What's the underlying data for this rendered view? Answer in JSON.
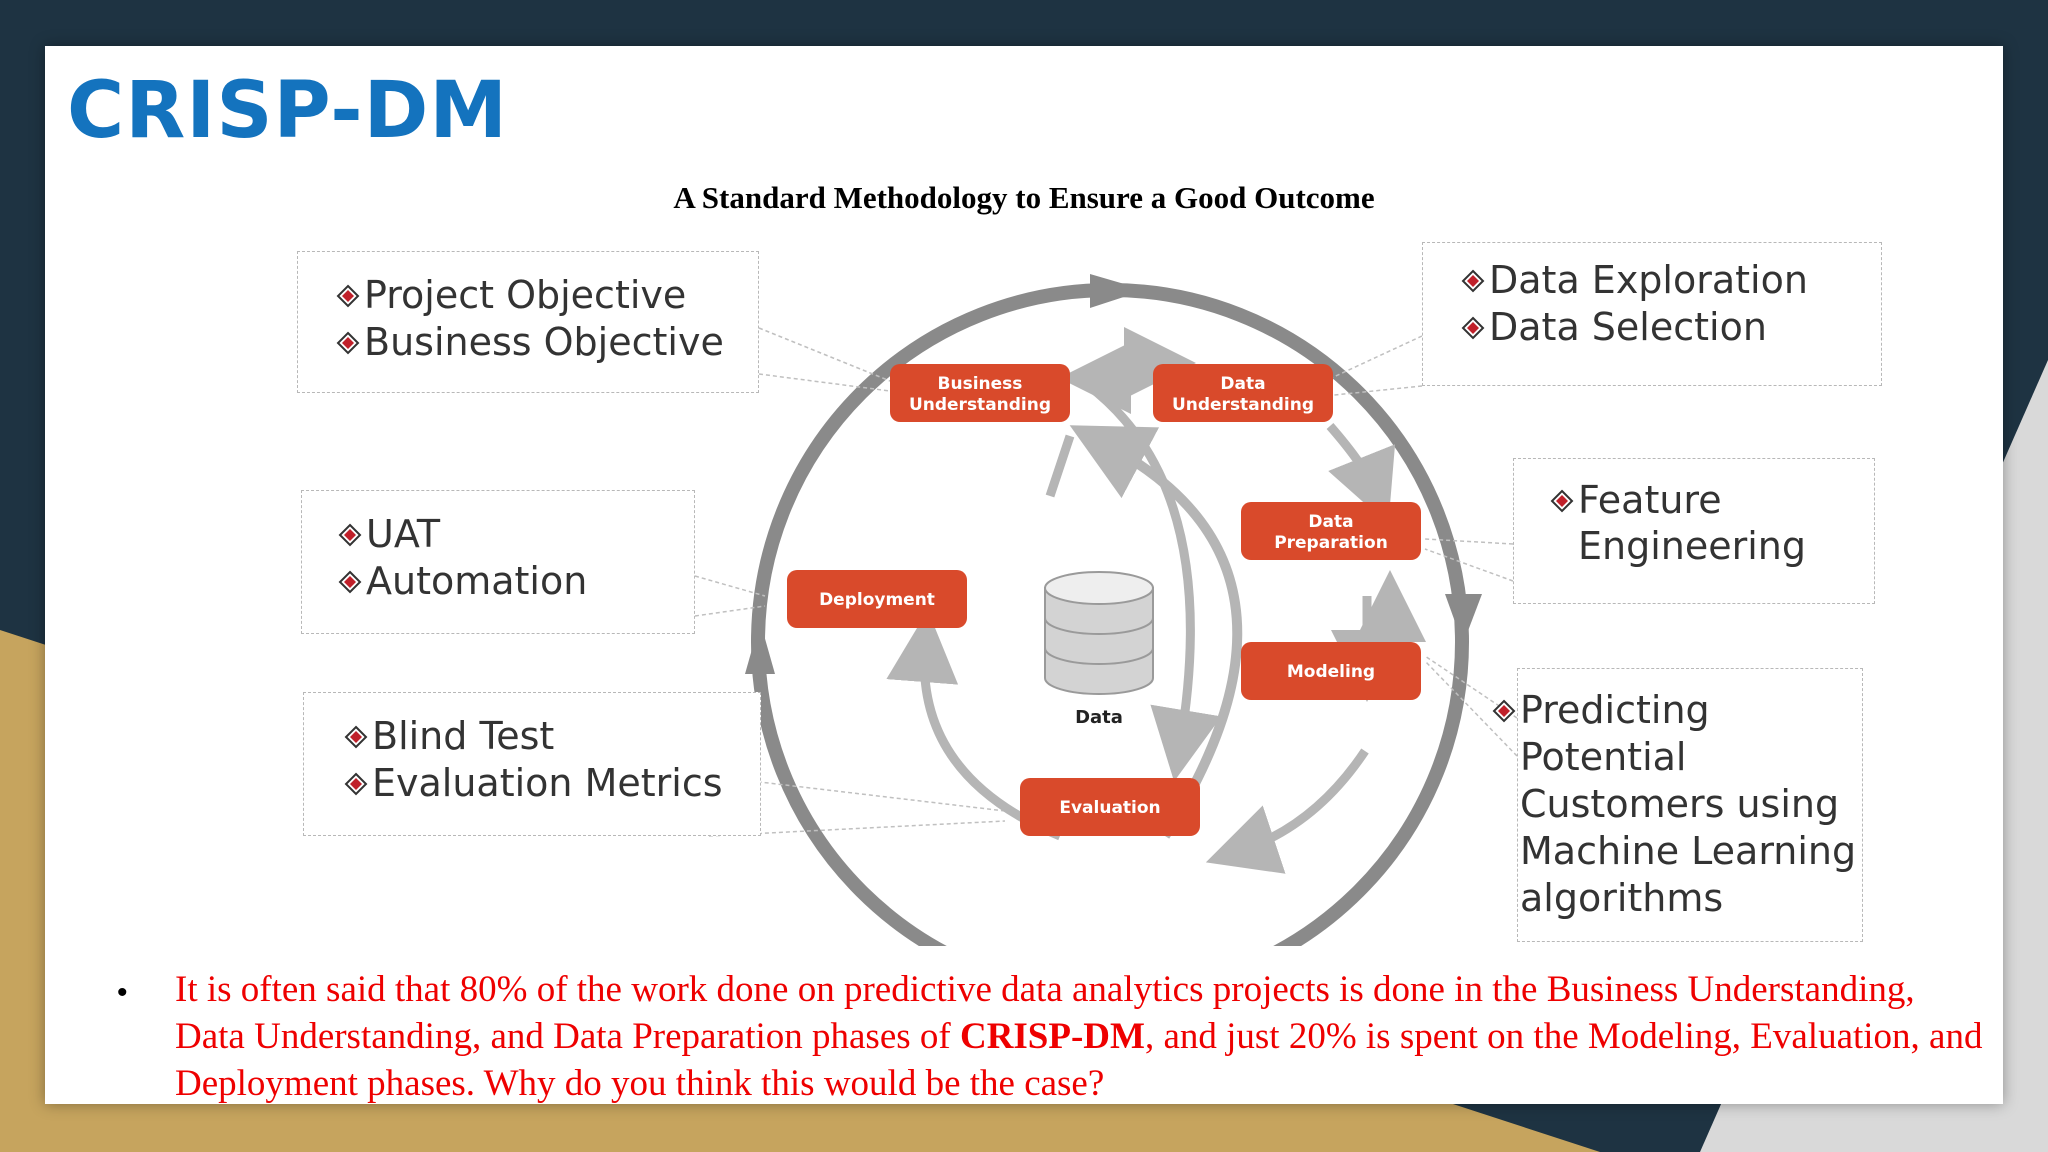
{
  "title": "CRISP-DM",
  "subtitle": "A Standard Methodology to Ensure a Good Outcome",
  "phases": {
    "business_understanding": [
      "Business",
      "Understanding"
    ],
    "data_understanding": [
      "Data",
      "Understanding"
    ],
    "data_preparation": [
      "Data",
      "Preparation"
    ],
    "modeling": "Modeling",
    "evaluation": "Evaluation",
    "deployment": "Deployment"
  },
  "data_label": "Data",
  "callouts": {
    "business": [
      "Project Objective",
      "Business Objective"
    ],
    "data_understanding": [
      "Data Exploration",
      "Data Selection"
    ],
    "data_preparation": [
      "Feature",
      "Engineering"
    ],
    "modeling": [
      "Predicting",
      "Potential",
      "Customers using",
      "Machine Learning",
      "algorithms"
    ],
    "deployment": [
      "UAT",
      "Automation"
    ],
    "evaluation": [
      "Blind Test",
      "Evaluation Metrics"
    ]
  },
  "question": {
    "part1": "It is often said that 80% of the work done on predictive data analytics projects is done in the Business Understanding, Data Understanding, and Data Preparation phases of ",
    "emphasis": "CRISP-DM",
    "part2": ", and just 20% is spent on the Modeling, Evaluation, and Deployment phases. Why do you think this would be the case?"
  },
  "colors": {
    "title": "#1473be",
    "phase_box": "#d94a2b",
    "question_text": "#ee0000",
    "cycle_ring": "#8a8a8a",
    "inner_arrow": "#b5b5b5",
    "background_navy": "#1e3342",
    "background_gold": "#c6a45e"
  },
  "icons": [
    "red-diamond-bullet-icon",
    "database-cylinder-icon"
  ]
}
